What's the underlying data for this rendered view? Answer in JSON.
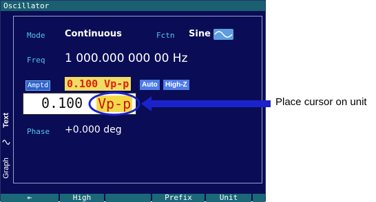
{
  "window": {
    "title": "Oscillator"
  },
  "fields": {
    "mode_label": "Mode",
    "mode_value": "Continuous",
    "fctn_label": "Fctn",
    "fctn_value": "Sine",
    "freq_label": "Freq",
    "freq_value": "1 000.000 000 00 Hz",
    "amptd_label": "Amptd",
    "amptd_value": "0.100 Vp-p",
    "auto_chip": "Auto",
    "highz_chip": "High-Z",
    "phase_label": "Phase",
    "phase_value": "+0.000 deg"
  },
  "entry": {
    "number": "0.100",
    "unit": "Vp-p"
  },
  "side_tabs": {
    "text": "Text",
    "graph": "Graph"
  },
  "softkeys": [
    "⇤",
    "High",
    "",
    "Prefix",
    "Unit",
    ""
  ],
  "annotation": "Place cursor on unit",
  "colors": {
    "screen_bg": "#0a0d55",
    "label": "#55c4e8",
    "highlight": "#f1dc66",
    "pointer": "#1a22cc"
  }
}
